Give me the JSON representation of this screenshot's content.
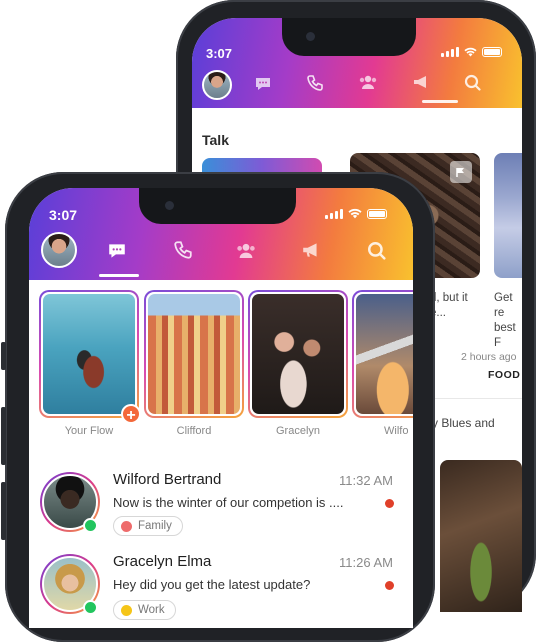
{
  "back_phone": {
    "status_time": "3:07",
    "section_title": "Talk",
    "card2_caption_line1": "d, but it",
    "card2_caption_line2": "e...",
    "card3_caption_line1": "Get re",
    "card3_caption_line2": "best F",
    "meta_time": "2 hours ago",
    "meta_category": "FOOD",
    "post_text": "y Blues and"
  },
  "front_phone": {
    "status_time": "3:07",
    "nav": {
      "items": [
        "profile",
        "chat",
        "calls",
        "contacts",
        "broadcast",
        "search"
      ],
      "active": "chat"
    },
    "stories": [
      {
        "label": "Your Flow",
        "badge": "+"
      },
      {
        "label": "Clifford"
      },
      {
        "label": "Gracelyn"
      },
      {
        "label": "Wilfo"
      }
    ],
    "chats": [
      {
        "name": "Wilford Bertrand",
        "time": "11:32 AM",
        "message": "Now is the winter of our competion is ....",
        "tag": "Family",
        "tag_color": "#ee6b6b",
        "online": true,
        "unread": true
      },
      {
        "name": "Gracelyn Elma",
        "time": "11:26 AM",
        "message": "Hey did you get the latest update?",
        "tag": "Work",
        "tag_color": "#f5c518",
        "online": true,
        "unread": true
      }
    ]
  },
  "colors": {
    "gradient_start": "#5a3fd8",
    "gradient_mid": "#e23a92",
    "gradient_end": "#f9c12e",
    "accent_orange": "#f3683a",
    "online_green": "#22c55e",
    "unread_red": "#e0402a"
  },
  "icons": {
    "chat": "chat-bubble-icon",
    "calls": "phone-icon",
    "contacts": "people-icon",
    "broadcast": "megaphone-icon",
    "search": "search-icon",
    "flag": "flag-icon"
  }
}
